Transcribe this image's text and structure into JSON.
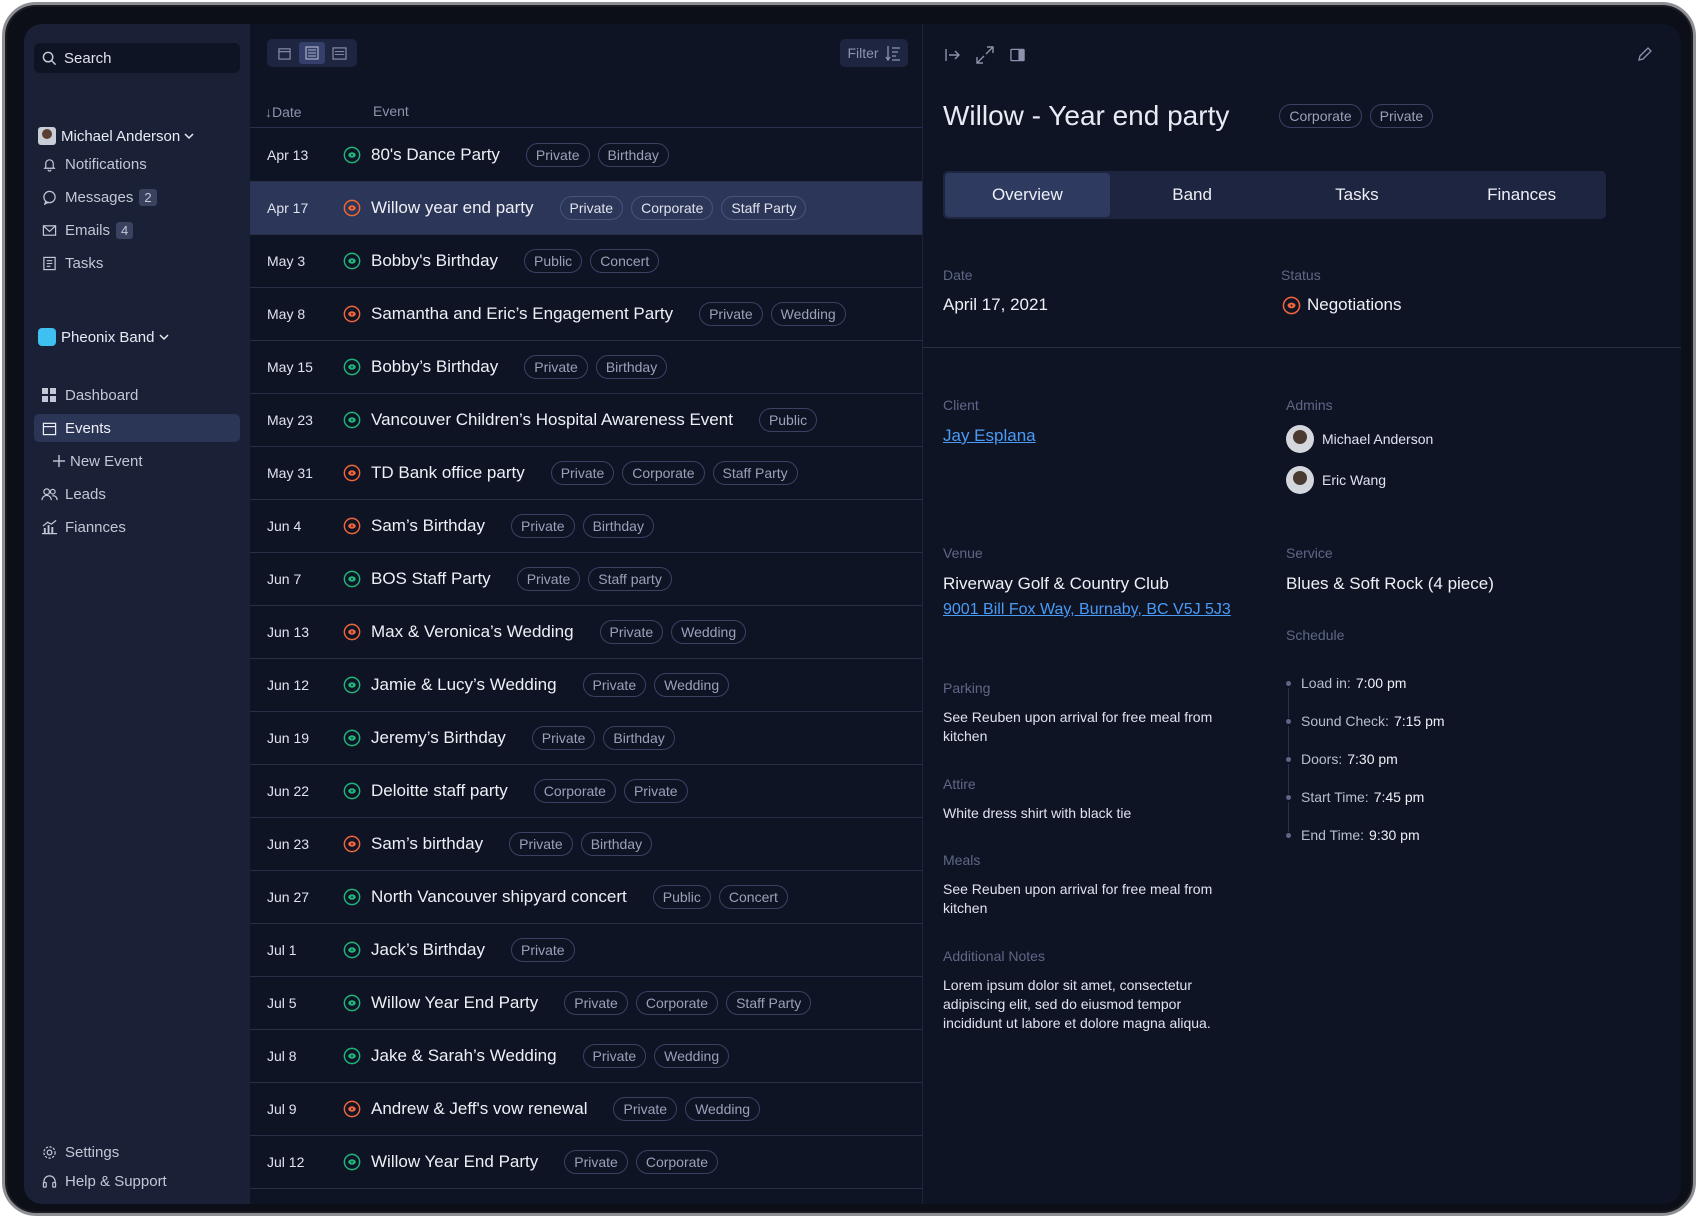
{
  "sidebar": {
    "search_placeholder": "Search",
    "user_name": "Michael Anderson",
    "nav": [
      {
        "label": "Notifications",
        "icon": "bell-icon"
      },
      {
        "label": "Messages",
        "icon": "chat-icon",
        "badge": "2"
      },
      {
        "label": "Emails",
        "icon": "mail-icon",
        "badge": "4"
      },
      {
        "label": "Tasks",
        "icon": "tasks-icon"
      }
    ],
    "band_name": "Pheonix Band",
    "band_nav": [
      {
        "label": "Dashboard",
        "icon": "grid-icon"
      },
      {
        "label": "Events",
        "icon": "calendar-icon"
      },
      {
        "label": "New Event",
        "icon": "plus-icon"
      },
      {
        "label": "Leads",
        "icon": "users-icon"
      },
      {
        "label": "Fiannces",
        "icon": "chart-icon"
      }
    ],
    "bottom": [
      {
        "label": "Settings",
        "icon": "gear-icon"
      },
      {
        "label": "Help & Support",
        "icon": "headset-icon"
      }
    ]
  },
  "list": {
    "filter_label": "Filter",
    "header_date": "↓Date",
    "header_event": "Event",
    "colors": {
      "green": "#1fb57a",
      "orange": "#f0663a"
    },
    "rows": [
      {
        "date": "Apr 13",
        "status": "green",
        "title": "80's Dance Party",
        "tags": [
          "Private",
          "Birthday"
        ]
      },
      {
        "date": "Apr 17",
        "status": "orange",
        "title": "Willow year end party",
        "tags": [
          "Private",
          "Corporate",
          "Staff Party"
        ],
        "selected": true
      },
      {
        "date": "May 3",
        "status": "green",
        "title": "Bobby's Birthday",
        "tags": [
          "Public",
          "Concert"
        ]
      },
      {
        "date": "May 8",
        "status": "orange",
        "title": "Samantha and Eric’s Engagement Party",
        "tags": [
          "Private",
          "Wedding"
        ]
      },
      {
        "date": "May 15",
        "status": "green",
        "title": "Bobby’s Birthday",
        "tags": [
          "Private",
          "Birthday"
        ]
      },
      {
        "date": "May 23",
        "status": "green",
        "title": "Vancouver Children’s Hospital Awareness Event",
        "tags": [
          "Public"
        ]
      },
      {
        "date": "May 31",
        "status": "orange",
        "title": "TD Bank office party",
        "tags": [
          "Private",
          "Corporate",
          "Staff Party"
        ]
      },
      {
        "date": "Jun 4",
        "status": "orange",
        "title": "Sam’s Birthday",
        "tags": [
          "Private",
          "Birthday"
        ]
      },
      {
        "date": "Jun 7",
        "status": "green",
        "title": "BOS Staff Party",
        "tags": [
          "Private",
          "Staff party"
        ]
      },
      {
        "date": "Jun 13",
        "status": "orange",
        "title": "Max & Veronica’s Wedding",
        "tags": [
          "Private",
          "Wedding"
        ]
      },
      {
        "date": "Jun 12",
        "status": "green",
        "title": "Jamie & Lucy’s Wedding",
        "tags": [
          "Private",
          "Wedding"
        ]
      },
      {
        "date": "Jun 19",
        "status": "green",
        "title": "Jeremy’s Birthday",
        "tags": [
          "Private",
          "Birthday"
        ]
      },
      {
        "date": "Jun 22",
        "status": "green",
        "title": "Deloitte staff party",
        "tags": [
          "Corporate",
          "Private"
        ]
      },
      {
        "date": "Jun 23",
        "status": "orange",
        "title": "Sam’s birthday",
        "tags": [
          "Private",
          "Birthday"
        ]
      },
      {
        "date": "Jun 27",
        "status": "green",
        "title": "North Vancouver shipyard concert",
        "tags": [
          "Public",
          "Concert"
        ]
      },
      {
        "date": "Jul 1",
        "status": "green",
        "title": "Jack’s Birthday",
        "tags": [
          "Private"
        ]
      },
      {
        "date": "Jul 5",
        "status": "green",
        "title": "Willow Year End Party",
        "tags": [
          "Private",
          "Corporate",
          "Staff Party"
        ]
      },
      {
        "date": "Jul 8",
        "status": "green",
        "title": "Jake & Sarah’s Wedding",
        "tags": [
          "Private",
          "Wedding"
        ]
      },
      {
        "date": "Jul 9",
        "status": "orange",
        "title": "Andrew & Jeff's vow renewal",
        "tags": [
          "Private",
          "Wedding"
        ]
      },
      {
        "date": "Jul 12",
        "status": "green",
        "title": "Willow Year End Party",
        "tags": [
          "Private",
          "Corporate"
        ]
      }
    ]
  },
  "detail": {
    "title": "Willow -  Year end party",
    "tags": [
      "Corporate",
      "Private"
    ],
    "tabs": [
      "Overview",
      "Band",
      "Tasks",
      "Finances"
    ],
    "date_label": "Date",
    "date_value": "April 17, 2021",
    "status_label": "Status",
    "status_value": "Negotiations",
    "client_label": "Client",
    "client_value": "Jay Esplana",
    "admins_label": "Admins",
    "admins": [
      "Michael Anderson",
      "Eric Wang"
    ],
    "venue_label": "Venue",
    "venue_name": "Riverway Golf & Country Club",
    "venue_address": "9001 Bill Fox Way, Burnaby, BC V5J 5J3",
    "service_label": "Service",
    "service_value": "Blues & Soft Rock (4 piece)",
    "schedule_label": "Schedule",
    "schedule": [
      {
        "k": "Load in:",
        "v": "7:00 pm"
      },
      {
        "k": "Sound Check:",
        "v": "7:15 pm"
      },
      {
        "k": "Doors:",
        "v": "7:30 pm"
      },
      {
        "k": "Start Time:",
        "v": "7:45 pm"
      },
      {
        "k": "End Time:",
        "v": "9:30 pm"
      }
    ],
    "parking_label": "Parking",
    "parking_value": "See Reuben upon arrival for free meal from kitchen",
    "attire_label": "Attire",
    "attire_value": "White dress shirt with black tie",
    "meals_label": "Meals",
    "meals_value": "See Reuben upon arrival for free meal from kitchen",
    "notes_label": "Additional Notes",
    "notes_value": "Lorem ipsum dolor sit amet, consectetur adipiscing elit, sed do eiusmod tempor incididunt ut labore et dolore magna aliqua."
  }
}
